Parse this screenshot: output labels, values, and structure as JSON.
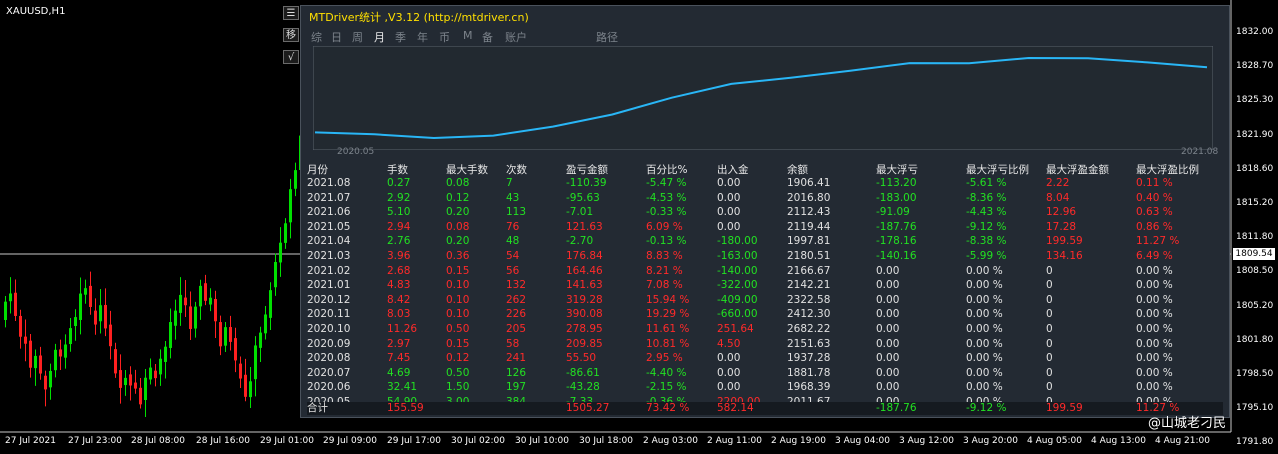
{
  "symbol": "XAUUSD,H1",
  "controls": [
    "☰",
    "移",
    "√"
  ],
  "panel": {
    "title": "MTDriver统计 ,V3.12 (http://mtdriver.cn)",
    "tabs": [
      "综",
      "日",
      "周",
      "月",
      "季",
      "年",
      "币",
      "M",
      "备",
      "账户",
      "路径"
    ],
    "active_tab": "月",
    "mini_chart": {
      "x_start": "2020.05",
      "x_end": "2021.08",
      "values": [
        2011.67,
        1968.39,
        1881.78,
        1937.28,
        2151.63,
        2682.22,
        2412.3,
        2322.58,
        2142.21,
        2166.67,
        2180.51,
        1997.81,
        2119.44,
        2112.43,
        2016.8,
        1906.41
      ]
    },
    "table": {
      "columns": [
        "月份",
        "手数",
        "最大手数",
        "次数",
        "盈亏金额",
        "百分比%",
        "出入金",
        "余额",
        "最大浮亏",
        "最大浮亏比例",
        "最大浮盈金额",
        "最大浮盈比例"
      ],
      "rows": [
        [
          "2021.08",
          "0.27",
          "0.08",
          "7",
          "-110.39",
          "-5.47 %",
          "0.00",
          "1906.41",
          "-113.20",
          "-5.61 %",
          "2.22",
          "0.11 %"
        ],
        [
          "2021.07",
          "2.92",
          "0.12",
          "43",
          "-95.63",
          "-4.53 %",
          "0.00",
          "2016.80",
          "-183.00",
          "-8.36 %",
          "8.04",
          "0.40 %"
        ],
        [
          "2021.06",
          "5.10",
          "0.20",
          "113",
          "-7.01",
          "-0.33 %",
          "0.00",
          "2112.43",
          "-91.09",
          "-4.43 %",
          "12.96",
          "0.63 %"
        ],
        [
          "2021.05",
          "2.94",
          "0.08",
          "76",
          "121.63",
          "6.09 %",
          "0.00",
          "2119.44",
          "-187.76",
          "-9.12 %",
          "17.28",
          "0.86 %"
        ],
        [
          "2021.04",
          "2.76",
          "0.20",
          "48",
          "-2.70",
          "-0.13 %",
          "-180.00",
          "1997.81",
          "-178.16",
          "-8.38 %",
          "199.59",
          "11.27 %"
        ],
        [
          "2021.03",
          "3.96",
          "0.36",
          "54",
          "176.84",
          "8.83 %",
          "-163.00",
          "2180.51",
          "-140.16",
          "-5.99 %",
          "134.16",
          "6.49 %"
        ],
        [
          "2021.02",
          "2.68",
          "0.15",
          "56",
          "164.46",
          "8.21 %",
          "-140.00",
          "2166.67",
          "0.00",
          "0.00 %",
          "0",
          "0.00 %"
        ],
        [
          "2021.01",
          "4.83",
          "0.10",
          "132",
          "141.63",
          "7.08 %",
          "-322.00",
          "2142.21",
          "0.00",
          "0.00 %",
          "0",
          "0.00 %"
        ],
        [
          "2020.12",
          "8.42",
          "0.10",
          "262",
          "319.28",
          "15.94 %",
          "-409.00",
          "2322.58",
          "0.00",
          "0.00 %",
          "0",
          "0.00 %"
        ],
        [
          "2020.11",
          "8.03",
          "0.10",
          "226",
          "390.08",
          "19.29 %",
          "-660.00",
          "2412.30",
          "0.00",
          "0.00 %",
          "0",
          "0.00 %"
        ],
        [
          "2020.10",
          "11.26",
          "0.50",
          "205",
          "278.95",
          "11.61 %",
          "251.64",
          "2682.22",
          "0.00",
          "0.00 %",
          "0",
          "0.00 %"
        ],
        [
          "2020.09",
          "2.97",
          "0.15",
          "58",
          "209.85",
          "10.81 %",
          "4.50",
          "2151.63",
          "0.00",
          "0.00 %",
          "0",
          "0.00 %"
        ],
        [
          "2020.08",
          "7.45",
          "0.12",
          "241",
          "55.50",
          "2.95 %",
          "0.00",
          "1937.28",
          "0.00",
          "0.00 %",
          "0",
          "0.00 %"
        ],
        [
          "2020.07",
          "4.69",
          "0.50",
          "126",
          "-86.61",
          "-4.40 %",
          "0.00",
          "1881.78",
          "0.00",
          "0.00 %",
          "0",
          "0.00 %"
        ],
        [
          "2020.06",
          "32.41",
          "1.50",
          "197",
          "-43.28",
          "-2.15 %",
          "0.00",
          "1968.39",
          "0.00",
          "0.00 %",
          "0",
          "0.00 %"
        ],
        [
          "2020.05",
          "54.90",
          "3.00",
          "384",
          "-7.33",
          "-0.36 %",
          "2200.00",
          "2011.67",
          "0.00",
          "0.00 %",
          "0",
          "0.00 %"
        ]
      ],
      "total": [
        "合计",
        "155.59",
        "",
        "",
        "1505.27",
        "73.42 %",
        "582.14",
        "",
        "-187.76",
        "-9.12 %",
        "199.59",
        "11.27 %"
      ]
    }
  },
  "price_axis": [
    "1832.00",
    "1828.70",
    "1825.30",
    "1821.90",
    "1818.60",
    "1815.20",
    "1811.80",
    "1808.50",
    "1805.20",
    "1801.80",
    "1798.50",
    "1795.10",
    "1791.80"
  ],
  "current_price": "1809.54",
  "time_axis": [
    "27 Jul 2021",
    "27 Jul 23:00",
    "28 Jul 08:00",
    "28 Jul 16:00",
    "29 Jul 01:00",
    "29 Jul 09:00",
    "29 Jul 17:00",
    "30 Jul 02:00",
    "30 Jul 10:00",
    "30 Jul 18:00",
    "2 Aug 03:00",
    "2 Aug 11:00",
    "2 Aug 19:00",
    "3 Aug 04:00",
    "3 Aug 12:00",
    "3 Aug 20:00",
    "4 Aug 05:00",
    "4 Aug 13:00",
    "4 Aug 21:00"
  ],
  "watermark": "@山城老刁民",
  "colors": {
    "up": "#00e000",
    "down": "#ff2020",
    "line": "#29b6f6",
    "title": "#ffe000",
    "panel": "#232a33"
  }
}
